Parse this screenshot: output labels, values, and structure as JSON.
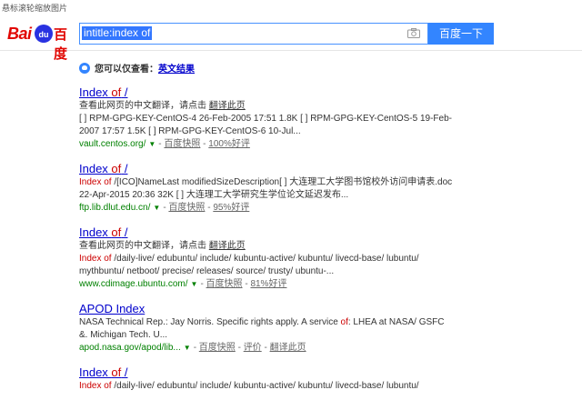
{
  "top_hint": "悬标滚轮缩放图片",
  "logo": {
    "bai": "Bai",
    "paw": "du",
    "du": "百度"
  },
  "search": {
    "query": "intitle:index of",
    "button": "百度一下"
  },
  "notice": {
    "text": "您可以仅查看：",
    "link": "英文结果"
  },
  "results": [
    {
      "title_prefix": "Index ",
      "title_hl": "of",
      "title_suffix": " /",
      "lines": [
        {
          "text": "查看此网页的中文翻译，请点击 ",
          "link": "翻译此页"
        },
        {
          "text": "[ ] RPM-GPG-KEY-CentOS-4 26-Feb-2005 17:51 1.8K [ ] RPM-GPG-KEY-CentOS-5 19-Feb-"
        },
        {
          "text": "2007 17:57 1.5K [ ] RPM-GPG-KEY-CentOS-6 10-Jul..."
        }
      ],
      "url": "vault.centos.org/",
      "snapshot": "百度快照",
      "extra": "100%好评"
    },
    {
      "title_prefix": "Index ",
      "title_hl": "of",
      "title_suffix": " /",
      "lines": [
        {
          "pre": "Index ",
          "hl": "of",
          "text": " /[ICO]NameLast modifiedSizeDescription[ ] 大连理工大学图书馆校外访问申请表.doc"
        },
        {
          "text": "22-Apr-2015 20:36 32K [ ] 大连理工大学研究生学位论文延迟发布..."
        }
      ],
      "url": "ftp.lib.dlut.edu.cn/",
      "snapshot": "百度快照",
      "extra": "95%好评"
    },
    {
      "title_prefix": "Index ",
      "title_hl": "of",
      "title_suffix": " /",
      "lines": [
        {
          "text": "查看此网页的中文翻译，请点击 ",
          "link": "翻译此页"
        },
        {
          "pre": "Index ",
          "hl": "of",
          "text": " /daily-live/ edubuntu/ include/ kubuntu-active/ kubuntu/ livecd-base/ lubuntu/"
        },
        {
          "text": "mythbuntu/ netboot/ precise/ releases/ source/ trusty/ ubuntu-..."
        }
      ],
      "url": "www.cdimage.ubuntu.com/",
      "snapshot": "百度快照",
      "extra": "81%好评"
    },
    {
      "title_prefix": "APOD Index",
      "title_hl": "",
      "title_suffix": "",
      "lines": [
        {
          "text": "NASA Technical Rep.: Jay Norris. Specific rights apply. A service ",
          "hl2": "of",
          "tail": ": LHEA at NASA/ GSFC"
        },
        {
          "text": "&. Michigan Tech. U..."
        }
      ],
      "url": "apod.nasa.gov/apod/lib...",
      "snapshot": "百度快照",
      "extra": "评价",
      "extra2": "翻译此页"
    },
    {
      "title_prefix": "Index ",
      "title_hl": "of",
      "title_suffix": " /",
      "lines": [
        {
          "pre": "Index ",
          "hl": "of",
          "text": " /daily-live/ edubuntu/ include/ kubuntu-active/ kubuntu/ livecd-base/ lubuntu/"
        }
      ],
      "url": "",
      "snapshot": "",
      "extra": ""
    }
  ]
}
